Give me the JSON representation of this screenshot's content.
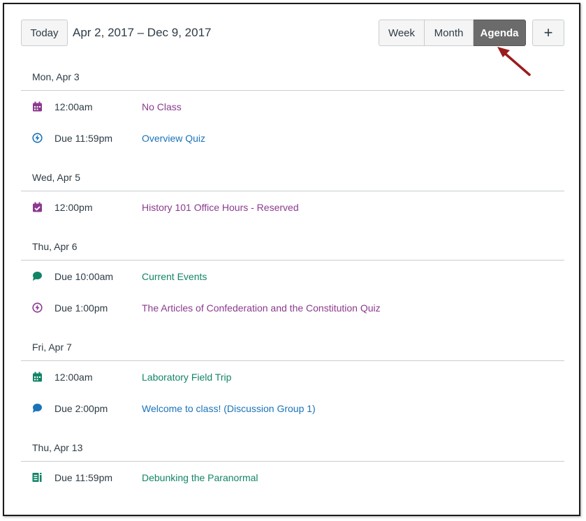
{
  "header": {
    "today_label": "Today",
    "date_range": "Apr 2, 2017 – Dec 9, 2017",
    "views": [
      "Week",
      "Month",
      "Agenda"
    ],
    "active_view": "Agenda",
    "add_label": "+"
  },
  "colors": {
    "purple": "#8b3a8f",
    "blue": "#1a73b8",
    "green": "#128467",
    "active_view_bg": "#6b6b6b",
    "arrow": "#9b1c1c"
  },
  "days": [
    {
      "label": "Mon, Apr 3",
      "events": [
        {
          "icon": "calendar-icon",
          "time": "12:00am",
          "title": "No Class",
          "color": "purple"
        },
        {
          "icon": "quiz-icon",
          "time": "Due 11:59pm",
          "title": "Overview Quiz",
          "color": "blue"
        }
      ]
    },
    {
      "label": "Wed, Apr 5",
      "events": [
        {
          "icon": "calendar-reserved-icon",
          "time": "12:00pm",
          "title": "History 101 Office Hours - Reserved",
          "color": "purple"
        }
      ]
    },
    {
      "label": "Thu, Apr 6",
      "events": [
        {
          "icon": "discussion-icon",
          "time": "Due 10:00am",
          "title": "Current Events",
          "color": "green"
        },
        {
          "icon": "quiz-icon",
          "time": "Due 1:00pm",
          "title": "The Articles of Confederation and the Constitution Quiz",
          "color": "purple"
        }
      ]
    },
    {
      "label": "Fri, Apr 7",
      "events": [
        {
          "icon": "calendar-icon",
          "time": "12:00am",
          "title": "Laboratory Field Trip",
          "color": "green"
        },
        {
          "icon": "discussion-icon",
          "time": "Due 2:00pm",
          "title": "Welcome to class! (Discussion Group 1)",
          "color": "blue"
        }
      ]
    },
    {
      "label": "Thu, Apr 13",
      "events": [
        {
          "icon": "assignment-icon",
          "time": "Due 11:59pm",
          "title": "Debunking the Paranormal",
          "color": "green"
        }
      ]
    }
  ]
}
